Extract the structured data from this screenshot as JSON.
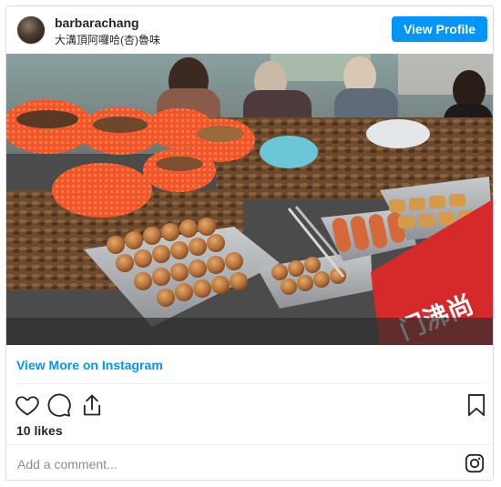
{
  "post": {
    "username": "barbarachang",
    "location": "大溝頂阿囉哈(杏)魯味",
    "view_profile_label": "View Profile",
    "view_more_label": "View More on Instagram",
    "likes_text": "10 likes",
    "comment_placeholder": "Add a comment..."
  },
  "photo": {
    "sign_text": "门沸尚"
  },
  "icons": {
    "avatar": "profile-avatar",
    "like": "heart-icon",
    "comment": "comment-icon",
    "share": "share-icon",
    "save": "bookmark-icon",
    "instagram": "instagram-icon"
  },
  "colors": {
    "accent": "#0095f6",
    "text": "#262626",
    "muted": "#8e8e8e",
    "border": "#dbdbdb"
  }
}
